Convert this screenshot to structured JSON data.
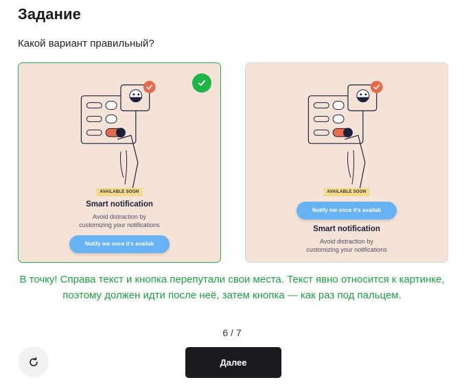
{
  "page": {
    "title": "Задание",
    "question": "Какой вариант правильный?"
  },
  "options": [
    {
      "badge": "AVAILABLE SOON",
      "card_title": "Smart notification",
      "description_line1": "Avoid distraction by",
      "description_line2": "customizing your notifications",
      "button_label": "Notify me once it's availab",
      "selected": true,
      "correct": true
    },
    {
      "badge": "AVAILABLE SOON",
      "card_title": "Smart notification",
      "description_line1": "Avoid distraction by",
      "description_line2": "customizing your notifications",
      "button_label": "Notify me once it's availab",
      "selected": false,
      "correct": false
    }
  ],
  "feedback": "В точку! Справа текст и кнопка перепутали свои места. Текст явно относится к картинке, поэтому должен идти после неё, затем кнопка — как раз под пальцем.",
  "progress": {
    "current": 6,
    "total": 7,
    "label": "6 / 7"
  },
  "controls": {
    "next_label": "Далее",
    "restart_icon": "refresh-icon"
  },
  "colors": {
    "correct": "#1db548",
    "card_bg": "#f6e3d8",
    "notify_button": "#66b2f2",
    "next_button": "#1b1b1f"
  }
}
